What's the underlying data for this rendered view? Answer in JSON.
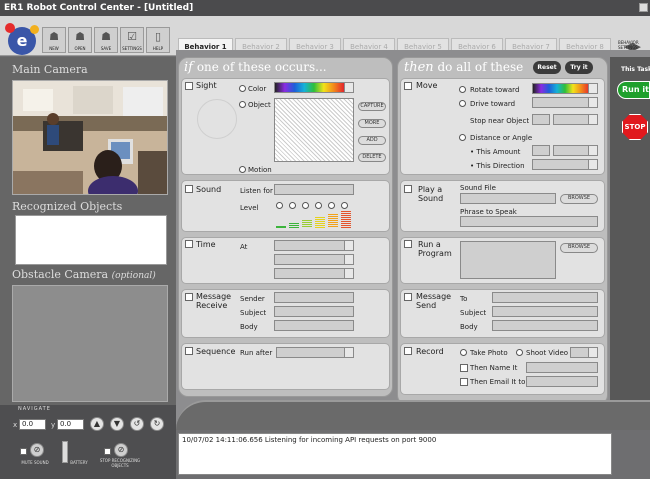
{
  "window": {
    "title": "ER1 Robot Control Center - [Untitled]"
  },
  "toolbar": {
    "buttons": [
      {
        "label": "NEW",
        "icon": "new-icon"
      },
      {
        "label": "OPEN",
        "icon": "open-icon"
      },
      {
        "label": "SAVE",
        "icon": "save-icon"
      },
      {
        "label": "SETTINGS",
        "icon": "settings-icon"
      },
      {
        "label": "HELP",
        "icon": "help-icon"
      }
    ],
    "logo_letter": "e"
  },
  "tabs": [
    "Behavior 1",
    "Behavior 2",
    "Behavior 3",
    "Behavior 4",
    "Behavior 5",
    "Behavior 6",
    "Behavior 7",
    "Behavior 8"
  ],
  "behavior_settings": {
    "line1": "BEHAVIOR",
    "line2": "SETTINGS"
  },
  "left": {
    "main_camera": "Main Camera",
    "recognized": "Recognized Objects",
    "obstacle": "Obstacle Camera",
    "obstacle_note": "(optional)"
  },
  "navigate": {
    "label": "NAVIGATE",
    "x_label": "x",
    "x_value": "0.0",
    "y_label": "y",
    "y_value": "0.0",
    "mute": "MUTE SOUND",
    "battery": "BATTERY",
    "stop": "STOP RECOGNIZING OBJECTS"
  },
  "if_panel": {
    "heading_italic": "if",
    "heading_rest": "one of these occurs...",
    "sight": {
      "title": "Sight",
      "color": "Color",
      "object": "Object",
      "motion": "Motion",
      "capture": "CAPTURE",
      "more": "MORE",
      "add": "ADD",
      "delete": "DELETE"
    },
    "sound": {
      "title": "Sound",
      "listen_for": "Listen for",
      "level": "Level"
    },
    "time": {
      "title": "Time",
      "at": "At"
    },
    "message": {
      "title1": "Message",
      "title2": "Receive",
      "sender": "Sender",
      "subject": "Subject",
      "body": "Body"
    },
    "sequence": {
      "title": "Sequence",
      "run_after": "Run after"
    }
  },
  "then_panel": {
    "heading_italic": "then",
    "heading_rest": "do all of these",
    "reset": "Reset",
    "tryit": "Try it",
    "move": {
      "title": "Move",
      "rotate": "Rotate toward",
      "drive": "Drive toward",
      "stop_near": "Stop near Object",
      "distance": "Distance or Angle",
      "amount": "• This Amount",
      "direction": "• This Direction"
    },
    "play": {
      "title1": "Play a",
      "title2": "Sound",
      "file": "Sound File",
      "speak": "Phrase to Speak",
      "browse": "BROWSE"
    },
    "program": {
      "title1": "Run a",
      "title2": "Program",
      "browse": "BROWSE"
    },
    "message": {
      "title1": "Message",
      "title2": "Send",
      "to": "To",
      "subject": "Subject",
      "body": "Body"
    },
    "record": {
      "title": "Record",
      "photo": "Take Photo",
      "video": "Shoot Video",
      "name": "Then Name It",
      "email": "Then Email It to"
    }
  },
  "side": {
    "title": "This Task",
    "run": "Run it",
    "stop": "STOP"
  },
  "log": {
    "text": "10/07/02 14:11:06.656 Listening for incoming API requests on port 9000"
  }
}
